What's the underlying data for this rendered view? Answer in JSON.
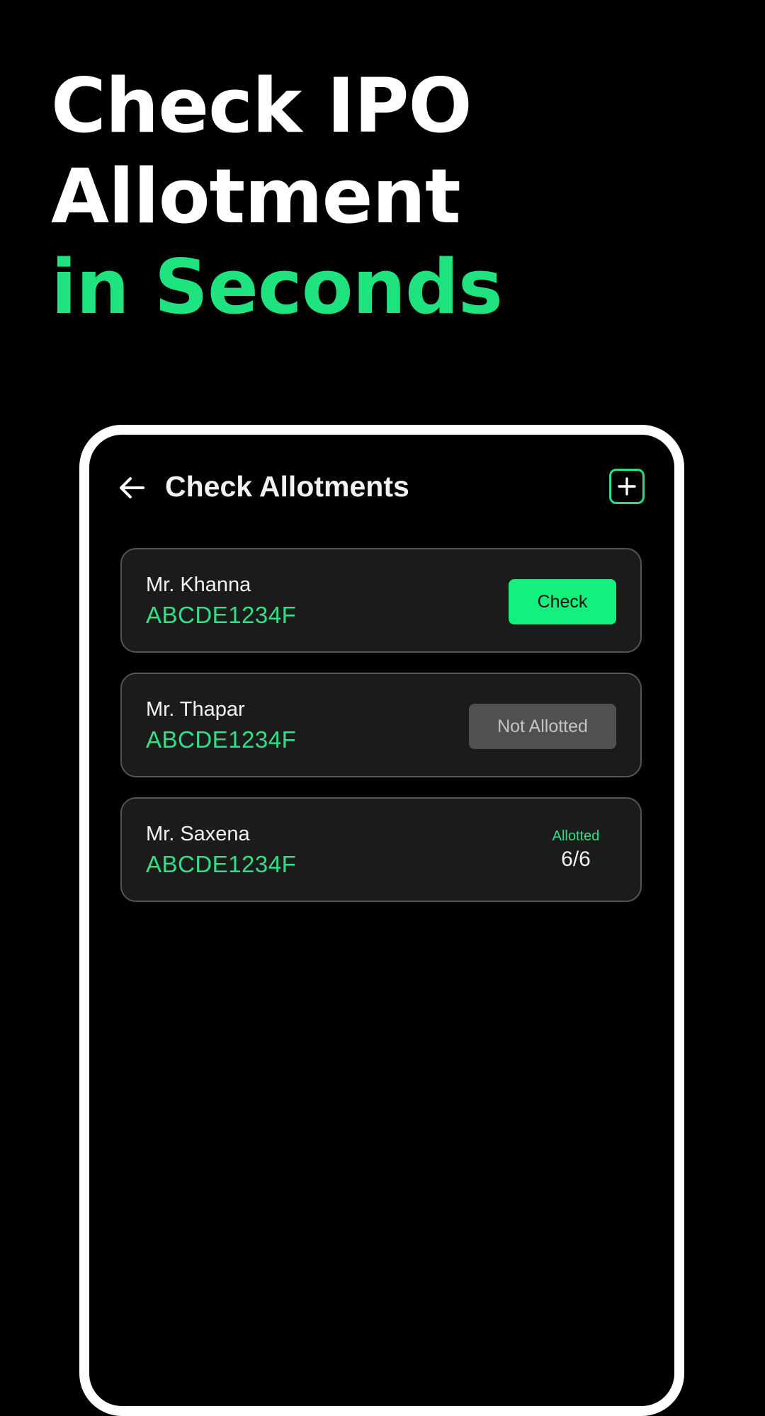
{
  "headline": {
    "line1": "Check IPO",
    "line2": "Allotment",
    "line3": "in Seconds",
    "accent_color": "#1ee37f"
  },
  "app": {
    "title": "Check Allotments",
    "back_icon": "arrow-left-icon",
    "add_icon": "plus-square-icon"
  },
  "cards": [
    {
      "name": "Mr. Khanna",
      "pan": "ABCDE1234F",
      "action_label": "Check"
    },
    {
      "name": "Mr. Thapar",
      "pan": "ABCDE1234F",
      "status_label": "Not Allotted"
    },
    {
      "name": "Mr. Saxena",
      "pan": "ABCDE1234F",
      "status_label": "Allotted",
      "status_value": "6/6"
    }
  ],
  "colors": {
    "background": "#000000",
    "accent": "#1ee37f",
    "button": "#14f07e",
    "card": "#1b1b1b",
    "chip": "#505050"
  }
}
